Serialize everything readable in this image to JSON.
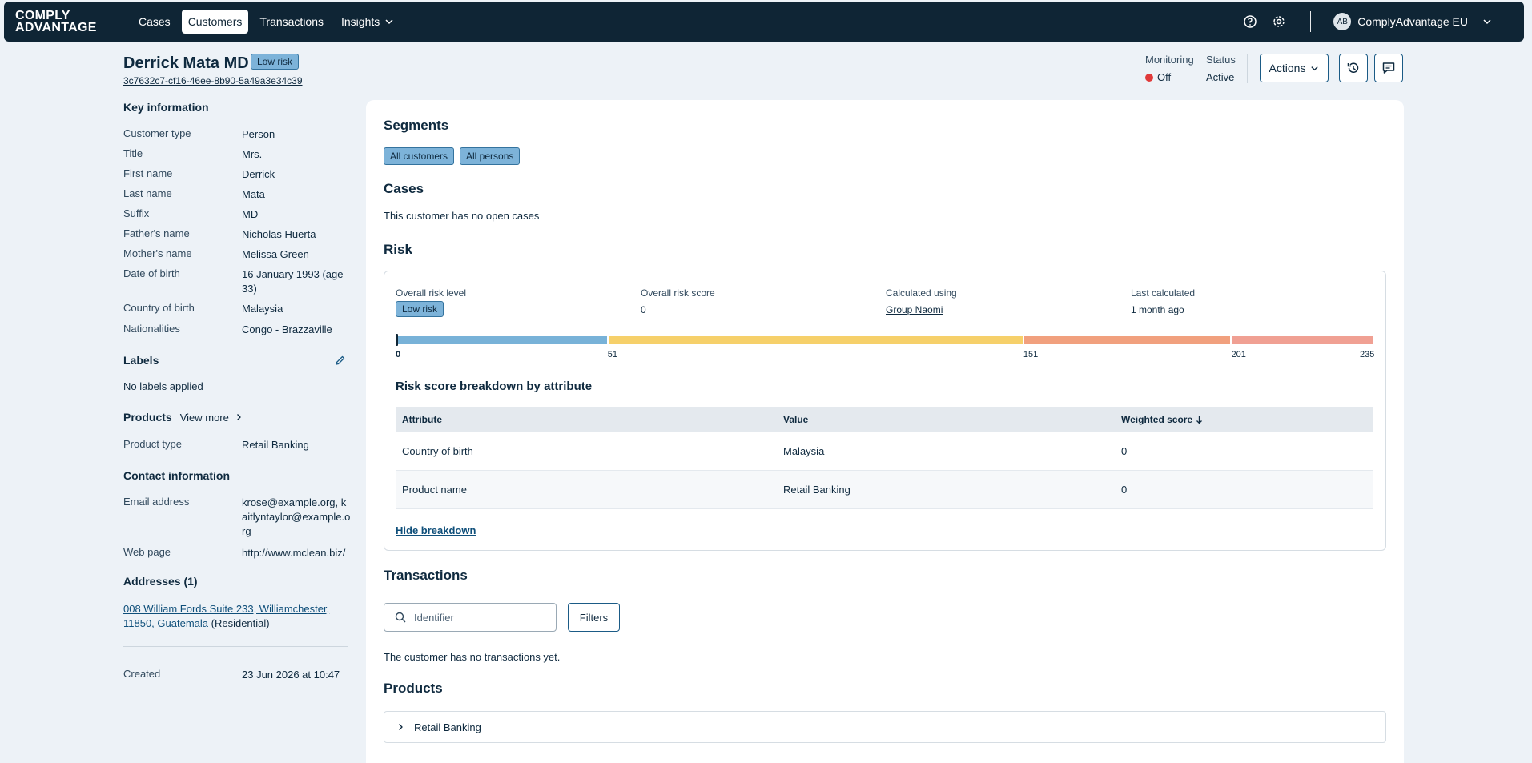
{
  "nav": {
    "logo_line1": "COMPLY",
    "logo_line2": "ADVANTAGE",
    "items": [
      {
        "label": "Cases"
      },
      {
        "label": "Customers"
      },
      {
        "label": "Transactions"
      },
      {
        "label": "Insights"
      }
    ],
    "account": {
      "initials": "AB",
      "name": "ComplyAdvantage EU"
    }
  },
  "header": {
    "customer_name": "Derrick Mata MD",
    "risk_badge": "Low risk",
    "customer_id": "3c7632c7-cf16-46ee-8b90-5a49a3e34c39",
    "monitoring_label": "Monitoring",
    "monitoring_value": "Off",
    "status_label": "Status",
    "status_value": "Active",
    "actions_label": "Actions"
  },
  "key_info": {
    "title": "Key information",
    "rows": [
      {
        "k": "Customer type",
        "v": "Person"
      },
      {
        "k": "Title",
        "v": "Mrs."
      },
      {
        "k": "First name",
        "v": "Derrick"
      },
      {
        "k": "Last name",
        "v": "Mata"
      },
      {
        "k": "Suffix",
        "v": "MD"
      },
      {
        "k": "Father's name",
        "v": "Nicholas Huerta"
      },
      {
        "k": "Mother's name",
        "v": "Melissa Green"
      },
      {
        "k": "Date of birth",
        "v": "16 January 1993 (age 33)"
      },
      {
        "k": "Country of birth",
        "v": "Malaysia"
      },
      {
        "k": "Nationalities",
        "v": "Congo - Brazzaville"
      }
    ]
  },
  "labels": {
    "title": "Labels",
    "empty": "No labels applied"
  },
  "products_side": {
    "title": "Products",
    "view_more": "View more",
    "type_label": "Product type",
    "type_value": "Retail Banking"
  },
  "contact": {
    "title": "Contact information",
    "email_label": "Email address",
    "email_value": "krose@example.org, kaitlyntaylor@example.org",
    "web_label": "Web page",
    "web_value": "http://www.mclean.biz/"
  },
  "addresses": {
    "title": "Addresses (1)",
    "address": "008 William Fords Suite 233, Williamchester, 11850, Guatemala",
    "kind": "(Residential)"
  },
  "created": {
    "label": "Created",
    "value": "23 Jun 2026 at 10:47"
  },
  "segments": {
    "title": "Segments",
    "chips": [
      "All customers",
      "All persons"
    ]
  },
  "cases": {
    "title": "Cases",
    "empty": "This customer has no open cases"
  },
  "risk": {
    "title": "Risk",
    "level_label": "Overall risk level",
    "level_value": "Low risk",
    "score_label": "Overall risk score",
    "score_value": "0",
    "calc_label": "Calculated using",
    "calc_value": "Group Naomi",
    "last_label": "Last calculated",
    "last_value": "1 month ago",
    "bar": {
      "min": 0,
      "max": 235,
      "score": 0,
      "bands": [
        {
          "from": 0,
          "to": 51,
          "color": "#78b2d8"
        },
        {
          "from": 51,
          "to": 151,
          "color": "#f6d06a"
        },
        {
          "from": 151,
          "to": 201,
          "color": "#f1a07e"
        },
        {
          "from": 201,
          "to": 235,
          "color": "#f0a093"
        }
      ],
      "ticks": [
        "0",
        "51",
        "151",
        "201",
        "235"
      ]
    },
    "breakdown_title": "Risk score breakdown by attribute",
    "columns": [
      "Attribute",
      "Value",
      "Weighted score"
    ],
    "rows": [
      {
        "attribute": "Country of birth",
        "value": "Malaysia",
        "score": "0"
      },
      {
        "attribute": "Product name",
        "value": "Retail Banking",
        "score": "0"
      }
    ],
    "hide_label": "Hide breakdown"
  },
  "transactions": {
    "title": "Transactions",
    "search_placeholder": "Identifier",
    "filters_label": "Filters",
    "empty": "The customer has no transactions yet."
  },
  "products_main": {
    "title": "Products",
    "item": "Retail Banking"
  }
}
